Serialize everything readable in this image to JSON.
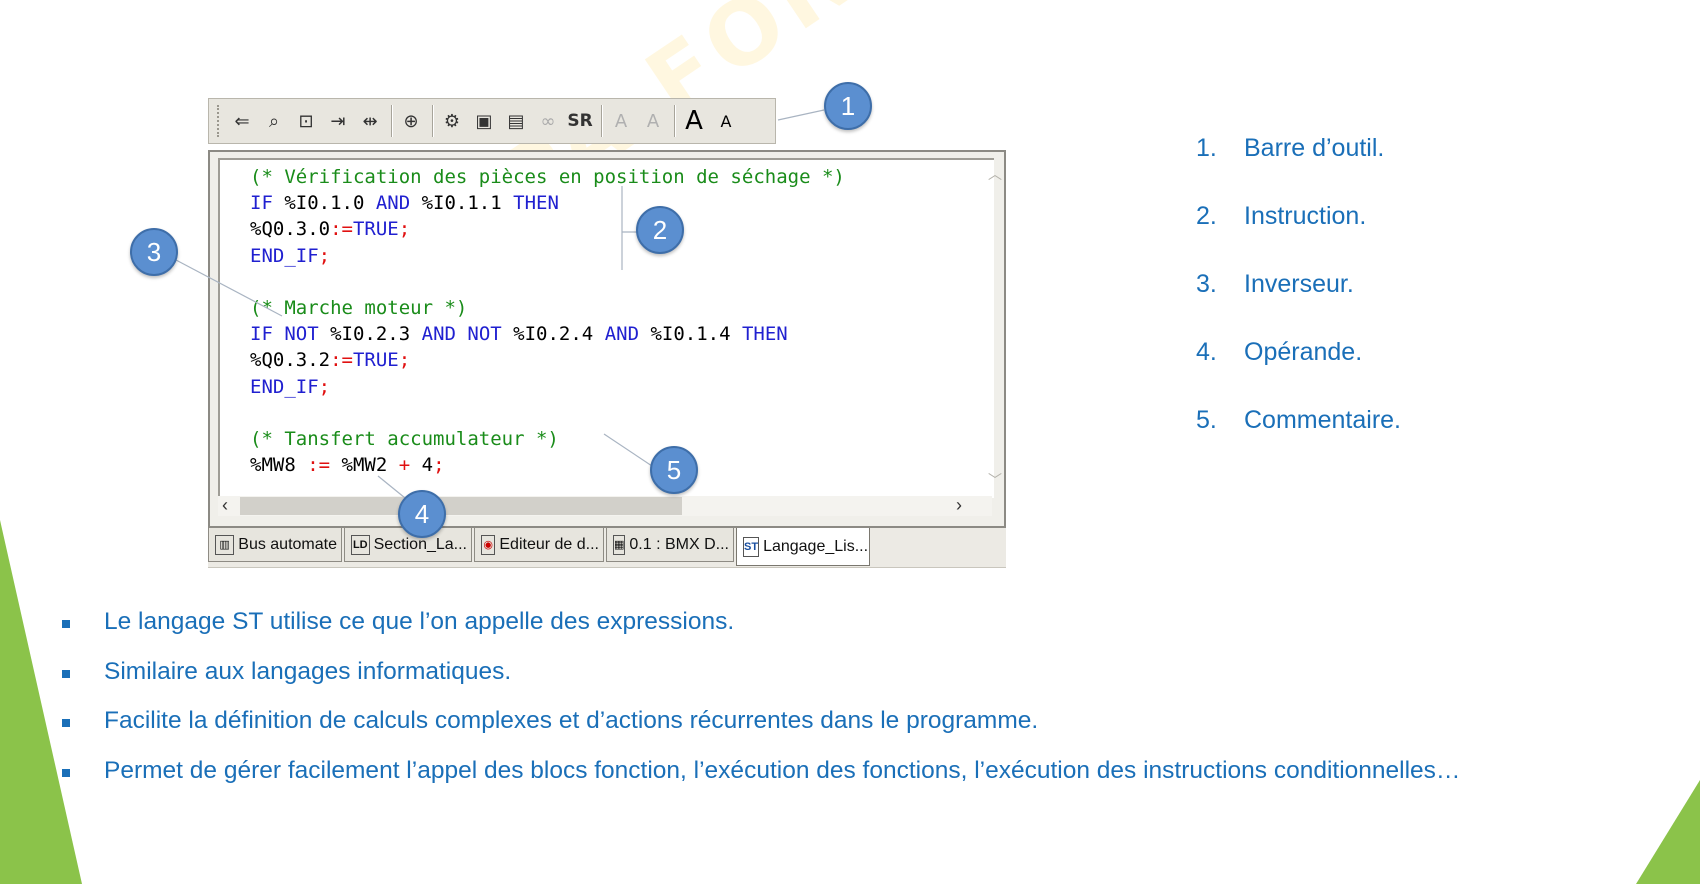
{
  "toolbar": {
    "icons": [
      "indent-left-icon",
      "search-replace-icon",
      "bookmark-icon",
      "goto-icon",
      "insert-icon",
      "zoom-icon",
      "dfb-icon",
      "variables-icon",
      "text-icon",
      "glasses-icon",
      "sr-icon",
      "fade-a-icon",
      "fade-a2-icon",
      "font-increase-icon",
      "font-decrease-icon"
    ],
    "sr_label": "SR"
  },
  "code": {
    "lines": [
      [
        {
          "t": "(* Vérification des pièces en position de séchage *)",
          "c": "com"
        }
      ],
      [
        {
          "t": "IF",
          "c": "kw"
        },
        {
          "t": " %I0.1.0 ",
          "c": "id"
        },
        {
          "t": "AND",
          "c": "kw"
        },
        {
          "t": " %I0.1.1 ",
          "c": "id"
        },
        {
          "t": "THEN",
          "c": "kw"
        }
      ],
      [
        {
          "t": "%Q0.3.0",
          "c": "id"
        },
        {
          "t": ":=",
          "c": "op"
        },
        {
          "t": "TRUE",
          "c": "kw"
        },
        {
          "t": ";",
          "c": "op"
        }
      ],
      [
        {
          "t": "END_IF",
          "c": "kw"
        },
        {
          "t": ";",
          "c": "op"
        }
      ],
      [
        {
          "t": "",
          "c": "id"
        }
      ],
      [
        {
          "t": "(* Marche moteur *)",
          "c": "com"
        }
      ],
      [
        {
          "t": "IF",
          "c": "kw"
        },
        {
          "t": " ",
          "c": "id"
        },
        {
          "t": "NOT",
          "c": "kw"
        },
        {
          "t": " %I0.2.3 ",
          "c": "id"
        },
        {
          "t": "AND",
          "c": "kw"
        },
        {
          "t": " ",
          "c": "id"
        },
        {
          "t": "NOT",
          "c": "kw"
        },
        {
          "t": " %I0.2.4 ",
          "c": "id"
        },
        {
          "t": "AND",
          "c": "kw"
        },
        {
          "t": " %I0.1.4 ",
          "c": "id"
        },
        {
          "t": "THEN",
          "c": "kw"
        }
      ],
      [
        {
          "t": "%Q0.3.2",
          "c": "id"
        },
        {
          "t": ":=",
          "c": "op"
        },
        {
          "t": "TRUE",
          "c": "kw"
        },
        {
          "t": ";",
          "c": "op"
        }
      ],
      [
        {
          "t": "END_IF",
          "c": "kw"
        },
        {
          "t": ";",
          "c": "op"
        }
      ],
      [
        {
          "t": "",
          "c": "id"
        }
      ],
      [
        {
          "t": "(* Tansfert accumulateur *)",
          "c": "com"
        }
      ],
      [
        {
          "t": "%MW8",
          "c": "id"
        },
        {
          "t": " := ",
          "c": "op"
        },
        {
          "t": "%MW2",
          "c": "id"
        },
        {
          "t": " + ",
          "c": "op"
        },
        {
          "t": "4",
          "c": "id"
        },
        {
          "t": ";",
          "c": "op"
        }
      ]
    ]
  },
  "tabs": [
    {
      "label": "Bus automate",
      "icon": "bus-icon",
      "glyph": "▥"
    },
    {
      "label": "Section_La...",
      "icon": "ld-section-icon",
      "glyph": "LD"
    },
    {
      "label": "Editeur de d...",
      "icon": "data-editor-icon",
      "glyph": "◉"
    },
    {
      "label": "0.1 : BMX D...",
      "icon": "module-icon",
      "glyph": "▦"
    },
    {
      "label": "Langage_Lis...",
      "icon": "st-section-icon",
      "glyph": "ST"
    }
  ],
  "callouts": [
    "1",
    "2",
    "3",
    "4",
    "5"
  ],
  "legend": [
    {
      "num": "1.",
      "text": "Barre d’outil."
    },
    {
      "num": "2.",
      "text": "Instruction."
    },
    {
      "num": "3.",
      "text": "Inverseur."
    },
    {
      "num": "4.",
      "text": "Opérande."
    },
    {
      "num": "5.",
      "text": "Commentaire."
    }
  ],
  "bullets": [
    "Le langage ST utilise ce que l’on appelle des expressions.",
    "Similaire aux langages informatiques.",
    "Facilite la définition de calculs complexes et d’actions récurrentes dans le programme.",
    "Permet de gérer facilement l’appel des blocs fonction, l’exécution des fonctions, l’exécution des instructions conditionnelles…"
  ],
  "watermark": "AFPA FORMATION OUEST",
  "colors": {
    "accent": "#1a6fb8",
    "callout": "#5b8fd0",
    "green": "#8bc34a",
    "comment": "#1a8c1a",
    "keyword": "#2020d0",
    "operator": "#e01010"
  }
}
